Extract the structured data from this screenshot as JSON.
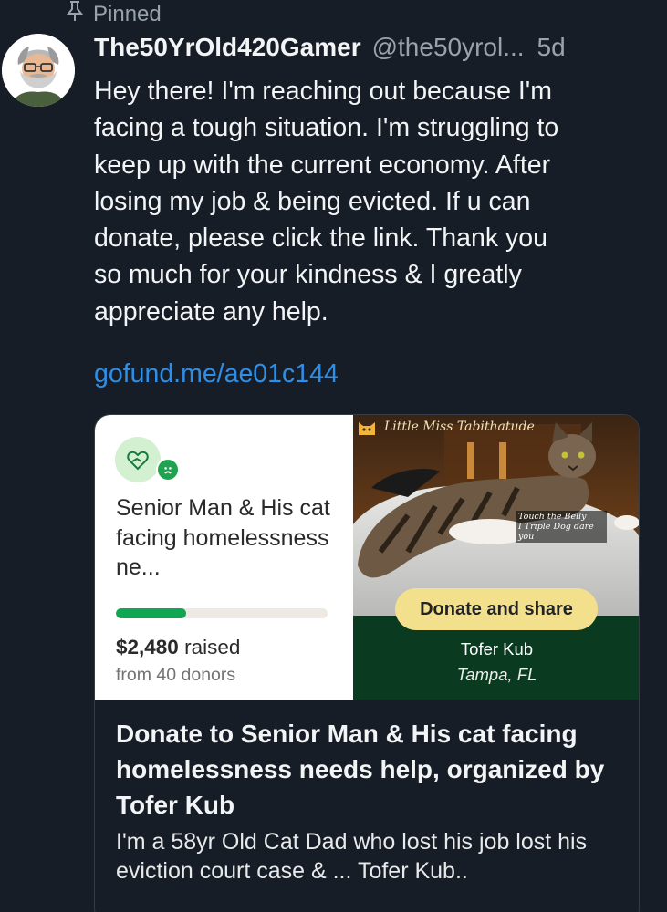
{
  "pinned_label": "Pinned",
  "post": {
    "display_name": "The50YrOld420Gamer",
    "handle": "@the50yrol...",
    "time": "5d",
    "text": "Hey there! I'm reaching out because I'm\nfacing a tough situation. I'm struggling to\nkeep up with the current economy.  After\nlosing my job & being evicted. If u can\ndonate, please click the link. Thank you\nso much for your kindness & I greatly\nappreciate any help.",
    "link": "gofund.me/ae01c144"
  },
  "card": {
    "fund_title": "Senior Man & His cat facing homelessness ne...",
    "progress_fraction": 0.33,
    "raised_amount": "$2,480",
    "raised_label": "raised",
    "donors": "from 40 donors",
    "photo_caption": "Little Miss Tabithatude",
    "photo_note_line1": "Touch the Belly",
    "photo_note_line2": "I Triple Dog dare you",
    "donate_button": "Donate and share",
    "organizer": "Tofer Kub",
    "location": "Tampa, FL",
    "headline": "Donate to Senior Man & His cat facing homelessness needs help, organized by Tofer Kub",
    "description": "I'm a 58yr Old Cat Dad who lost his job lost his eviction court case & ... Tofer Kub.."
  },
  "colors": {
    "background": "#171d26",
    "link": "#2e8fe8",
    "progress_fill": "#10a654",
    "donate_button": "#f3e08c",
    "card_green": "#0a3a1f"
  },
  "icons": {
    "pinned": "pin-icon",
    "avatar": "bearded-man-avatar",
    "gofundme": "gofundme-heart-hand-icon",
    "badge": "sad-face-icon"
  }
}
